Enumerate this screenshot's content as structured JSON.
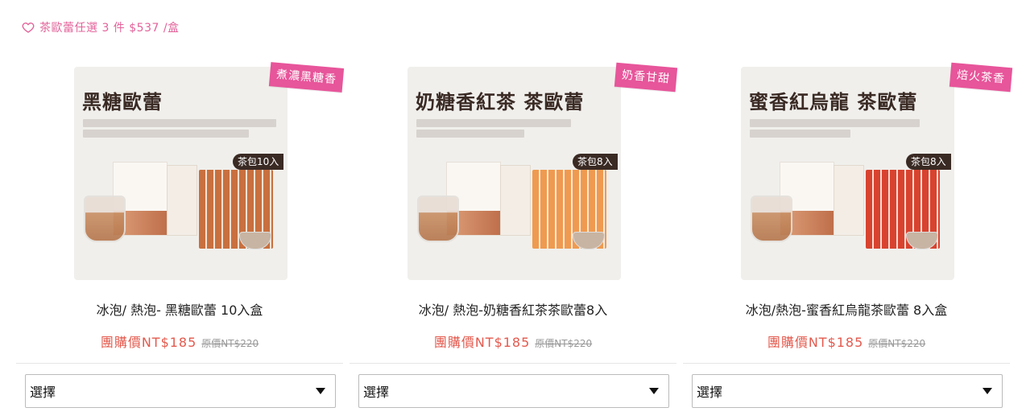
{
  "promo": {
    "text": "茶歐蕾任選 3 件 $537 /盒",
    "icon": "heart-outline-icon",
    "color": "#e2639a"
  },
  "colors": {
    "ribbon": "#e7559a",
    "price": "#e35a4e",
    "original": "#999999"
  },
  "products": [
    {
      "ribbon": "煮濃黑糖香",
      "image_title": "黑糖歐蕾",
      "pack_tag": "茶包10入",
      "name": "冰泡/ 熱泡- 黑糖歐蕾 10入盒",
      "price": "團購價NT$185",
      "original_price": "原價NT$220",
      "select_value": "選擇"
    },
    {
      "ribbon": "奶香甘甜",
      "image_title": "奶糖香紅茶 茶歐蕾",
      "pack_tag": "茶包8入",
      "name": "冰泡/ 熱泡-奶糖香紅茶茶歐蕾8入",
      "price": "團購價NT$185",
      "original_price": "原價NT$220",
      "select_value": "選擇"
    },
    {
      "ribbon": "焙火茶香",
      "image_title": "蜜香紅烏龍 茶歐蕾",
      "pack_tag": "茶包8入",
      "name": "冰泡/熱泡-蜜香紅烏龍茶歐蕾 8入盒",
      "price": "團購價NT$185",
      "original_price": "原價NT$220",
      "select_value": "選擇"
    }
  ]
}
